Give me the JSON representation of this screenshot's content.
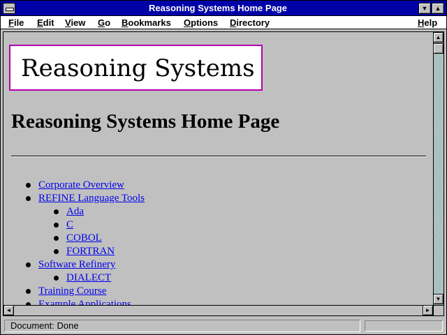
{
  "window": {
    "title": "Reasoning Systems Home Page",
    "min_glyph": "▼",
    "max_glyph": "▲"
  },
  "menu": {
    "items": [
      {
        "id": "file",
        "first": "F",
        "rest": "ile"
      },
      {
        "id": "edit",
        "first": "E",
        "rest": "dit"
      },
      {
        "id": "view",
        "first": "V",
        "rest": "iew"
      },
      {
        "id": "go",
        "first": "G",
        "rest": "o"
      },
      {
        "id": "bookmarks",
        "first": "B",
        "rest": "ookmarks"
      },
      {
        "id": "options",
        "first": "O",
        "rest": "ptions"
      },
      {
        "id": "directory",
        "first": "D",
        "rest": "irectory"
      },
      {
        "id": "help",
        "first": "H",
        "rest": "elp"
      }
    ]
  },
  "page": {
    "logo_text": "Reasoning Systems",
    "heading": "Reasoning Systems Home Page",
    "links": [
      {
        "label": "Corporate Overview",
        "level": 1
      },
      {
        "label": "REFINE Language Tools",
        "level": 1
      },
      {
        "label": "Ada",
        "level": 2
      },
      {
        "label": "C",
        "level": 2
      },
      {
        "label": "COBOL",
        "level": 2
      },
      {
        "label": "FORTRAN",
        "level": 2
      },
      {
        "label": "Software Refinery",
        "level": 1
      },
      {
        "label": "DIALECT",
        "level": 2
      },
      {
        "label": "Training Course",
        "level": 1
      },
      {
        "label": "Example Applications",
        "level": 1
      }
    ]
  },
  "scrollbar": {
    "up_glyph": "▲",
    "down_glyph": "▼",
    "left_glyph": "◄",
    "right_glyph": "►",
    "position": 0.0
  },
  "status": {
    "text": "Document: Done"
  },
  "icons": {
    "system_menu": "system-menu-icon",
    "minimize": "minimize-icon",
    "maximize": "maximize-icon"
  }
}
